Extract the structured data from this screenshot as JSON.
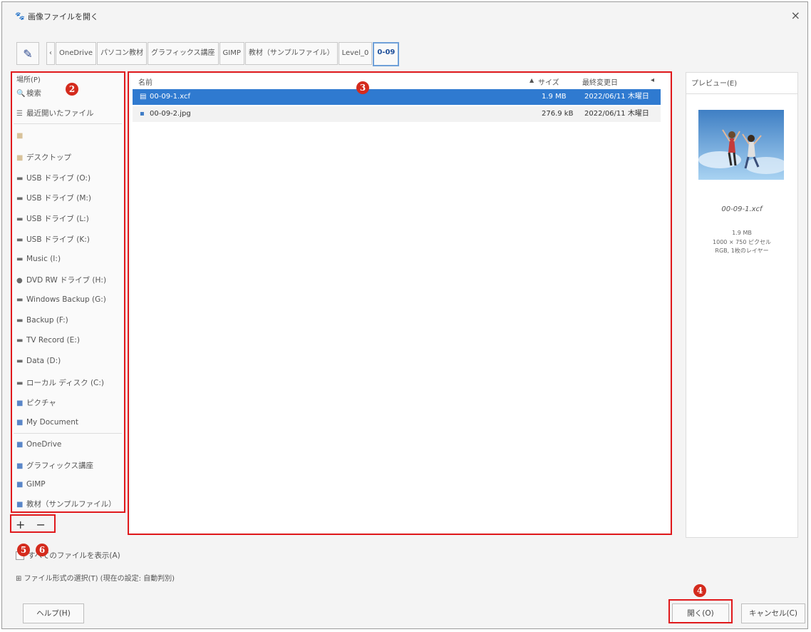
{
  "window": {
    "title": "画像ファイルを開く",
    "app_icon": "gimp-icon",
    "close": "×"
  },
  "pathbar": {
    "edit_icon": "pencil-icon",
    "scroll_left": "‹",
    "crumbs": [
      "OneDrive",
      "パソコン教材",
      "グラフィックス講座",
      "GIMP",
      "教材（サンプルファイル）",
      "Level_0",
      "0-09"
    ],
    "active_index": 6
  },
  "places": {
    "header": "場所(P)",
    "items": [
      {
        "label": "検索",
        "icon": "search-icon"
      },
      {
        "label": "最近開いたファイル",
        "icon": "recent-icon"
      },
      {
        "label": "",
        "icon": "folder-icon"
      },
      {
        "label": "デスクトップ",
        "icon": "folder-icon"
      },
      {
        "label": "USB ドライブ (O:)",
        "icon": "drive-icon"
      },
      {
        "label": "USB ドライブ (M:)",
        "icon": "drive-icon"
      },
      {
        "label": "USB ドライブ (L:)",
        "icon": "drive-icon"
      },
      {
        "label": "USB ドライブ (K:)",
        "icon": "drive-icon"
      },
      {
        "label": "Music (I:)",
        "icon": "drive-icon"
      },
      {
        "label": "DVD RW ドライブ (H:)",
        "icon": "dvd-icon"
      },
      {
        "label": "Windows Backup (G:)",
        "icon": "drive-icon"
      },
      {
        "label": "Backup (F:)",
        "icon": "drive-icon"
      },
      {
        "label": "TV Record (E:)",
        "icon": "drive-icon"
      },
      {
        "label": "Data (D:)",
        "icon": "drive-icon"
      },
      {
        "label": "ローカル ディスク (C:)",
        "icon": "drive-icon"
      },
      {
        "label": "ピクチャ",
        "icon": "folder-icon"
      },
      {
        "label": "My Document",
        "icon": "folder-icon"
      },
      {
        "label": "OneDrive",
        "icon": "folder-icon"
      },
      {
        "label": "グラフィックス講座",
        "icon": "folder-icon"
      },
      {
        "label": "GIMP",
        "icon": "folder-icon"
      },
      {
        "label": "教材（サンプルファイル）",
        "icon": "folder-icon"
      }
    ],
    "add": "+",
    "remove": "−"
  },
  "filelist": {
    "columns": {
      "name": "名前",
      "size": "サイズ",
      "modified": "最終変更日"
    },
    "sort_arrow": "▲",
    "rows": [
      {
        "name": "00-09-1.xcf",
        "size": "1.9 MB",
        "modified": "2022/06/11 木曜日",
        "icon": "xcf-file-icon",
        "selected": true
      },
      {
        "name": "00-09-2.jpg",
        "size": "276.9 kB",
        "modified": "2022/06/11 木曜日",
        "icon": "image-file-icon",
        "selected": false
      }
    ]
  },
  "preview": {
    "title": "プレビュー(E)",
    "filename": "00-09-1.xcf",
    "info": [
      "1.9 MB",
      "1000 × 750 ピクセル",
      "RGB, 1枚のレイヤー"
    ]
  },
  "options": {
    "show_all": "すべてのファイルを表示(A)",
    "file_type": "ファイル形式の選択(T) (現在の設定: 自動判別)",
    "expander": "⊞"
  },
  "buttons": {
    "help": "ヘルプ(H)",
    "open": "開く(O)",
    "cancel": "キャンセル(C)"
  },
  "annotations": {
    "b2": "2",
    "b3": "3",
    "b4": "4",
    "b5": "5",
    "b6": "6"
  },
  "colors": {
    "selection": "#2f7ad0",
    "annotation": "#e0191c",
    "badge": "#d42b1d"
  }
}
